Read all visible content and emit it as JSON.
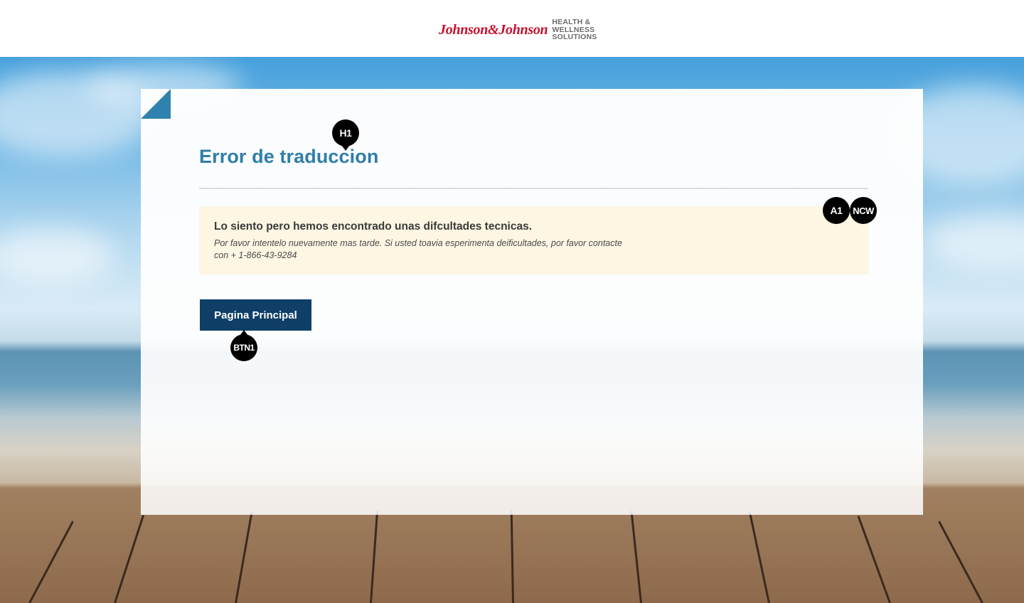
{
  "header": {
    "logo_script": "Johnson&Johnson",
    "logo_tag_lines": [
      "HEALTH &",
      "WELLNESS",
      "SOLUTIONS"
    ]
  },
  "error": {
    "title": "Error de traduccion",
    "alert_heading": "Lo siento pero hemos encontrado unas difcultades tecnicas.",
    "alert_body": "Por favor intentelo nuevamente mas tarde. Si usted toavia esperimenta deificultades, por favor contacte con + 1-866-43-9284"
  },
  "actions": {
    "home_button_label": "Pagina Principal"
  },
  "markers": {
    "h1": "H1",
    "a1": "A1",
    "ncw": "NCW",
    "btn1": "BTN1"
  },
  "colors": {
    "title_blue": "#2f7ea8",
    "button_navy": "#0f3f66",
    "alert_bg": "#fcf6e3",
    "fold_blue": "#2f82ad",
    "logo_red": "#c8102e"
  }
}
